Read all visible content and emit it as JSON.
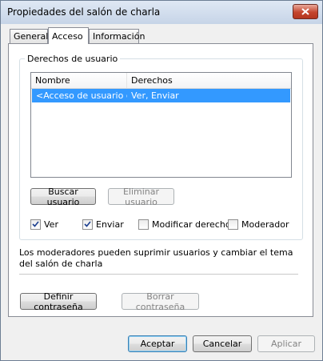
{
  "window": {
    "title": "Propiedades del salón de charla"
  },
  "tabs": [
    {
      "label": "General",
      "active": false
    },
    {
      "label": "Acceso",
      "active": true
    },
    {
      "label": "Información",
      "active": false
    }
  ],
  "access": {
    "group_label": "Derechos de usuario",
    "columns": [
      "Nombre",
      "Derechos"
    ],
    "rows": [
      {
        "name": "<Acceso de usuario g...",
        "rights": "Ver, Enviar",
        "selected": true
      }
    ],
    "buttons": {
      "search_user": "Buscar usuario",
      "remove_user": "Eliminar usuario"
    },
    "checkboxes": [
      {
        "label": "Ver",
        "checked": true
      },
      {
        "label": "Enviar",
        "checked": true
      },
      {
        "label": "Modificar derechos",
        "checked": false
      },
      {
        "label": "Moderador",
        "checked": false
      }
    ],
    "note": "Los moderadores pueden suprimir usuarios y cambiar el tema del salón de charla",
    "password_buttons": {
      "define": "Definir contraseña",
      "clear": "Borrar contraseña"
    }
  },
  "footer": {
    "ok": "Aceptar",
    "cancel": "Cancelar",
    "apply": "Aplicar"
  },
  "colors": {
    "selection": "#3399ff",
    "close_button": "#c4452d"
  }
}
